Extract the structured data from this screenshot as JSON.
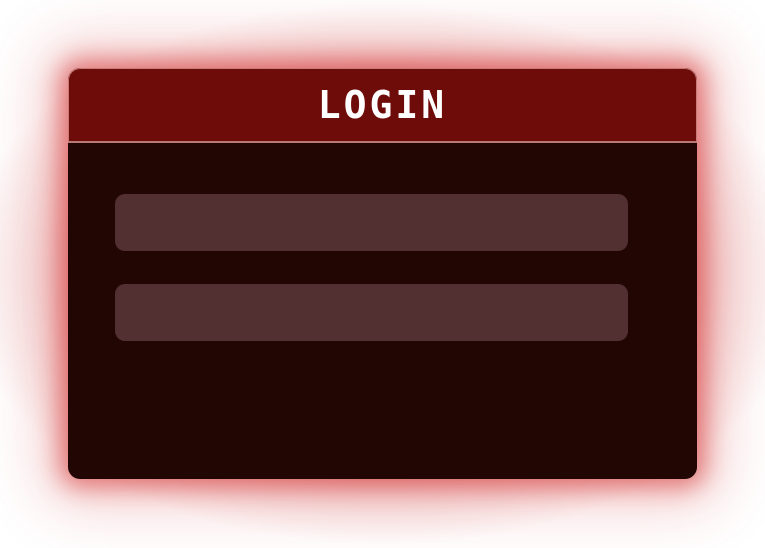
{
  "login": {
    "title": "LOGIN",
    "username": {
      "value": "",
      "placeholder": ""
    },
    "password": {
      "value": "",
      "placeholder": ""
    }
  },
  "colors": {
    "glow": "#c62828",
    "panel_background": "#220604",
    "header_background": "#6e0c0a",
    "header_border": "#c77b78",
    "field_background": "#523031",
    "title_text": "#ffffff"
  }
}
